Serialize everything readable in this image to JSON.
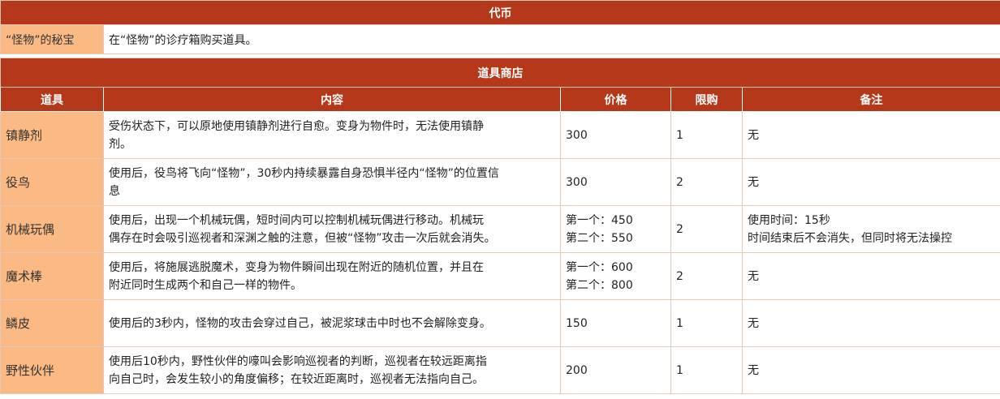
{
  "token_section": {
    "title": "代币",
    "label": "“怪物”的秘宝",
    "description": "在“怪物”的诊疗箱购买道具。"
  },
  "shop": {
    "title": "道具商店",
    "columns": [
      "道具",
      "内容",
      "价格",
      "限购",
      "备注"
    ],
    "rows": [
      {
        "name": "镇静剂",
        "content": [
          "受伤状态下，可以原地使用镇静剂进行自愈。变身为物件时，无法使用镇静",
          "剂。"
        ],
        "price": [
          "300"
        ],
        "limit": "1",
        "note": [
          "无"
        ]
      },
      {
        "name": "役鸟",
        "content": [
          "使用后，役鸟将飞向“怪物”，30秒内持续暴露自身恐惧半径内“怪物”的位置信",
          "息"
        ],
        "price": [
          "300"
        ],
        "limit": "2",
        "note": [
          "无"
        ]
      },
      {
        "name": "机械玩偶",
        "content": [
          "使用后，出现一个机械玩偶，短时间内可以控制机械玩偶进行移动。机械玩",
          "偶存在时会吸引巡视者和深渊之触的注意，但被“怪物”攻击一次后就会消失。"
        ],
        "price": [
          "第一个：450",
          "第二个：550"
        ],
        "limit": "2",
        "note": [
          "使用时间：15秒",
          "时间结束后不会消失，但同时将无法操控"
        ]
      },
      {
        "name": "魔术棒",
        "content": [
          "使用后，将施展逃脱魔术，变身为物件瞬间出现在附近的随机位置，并且在",
          "附近同时生成两个和自己一样的物件。"
        ],
        "price": [
          "第一个：600",
          "第二个：800"
        ],
        "limit": "2",
        "note": [
          "无"
        ]
      },
      {
        "name": "鳞皮",
        "content": [
          "使用后的3秒内，怪物的攻击会穿过自己，被泥浆球击中时也不会解除变身。"
        ],
        "price": [
          "150"
        ],
        "limit": "1",
        "note": [
          "无"
        ]
      },
      {
        "name": "野性伙伴",
        "content": [
          "使用后10秒内，野性伙伴的嚎叫会影响巡视者的判断，巡视者在较远距离指",
          "向自己时，会发生较小的角度偏移；在较近距离时，巡视者无法指向自己。"
        ],
        "price": [
          "200"
        ],
        "limit": "1",
        "note": [
          "无"
        ]
      }
    ]
  },
  "colors": {
    "header_bg": "#b5381a",
    "label_bg": "#fbb983"
  }
}
